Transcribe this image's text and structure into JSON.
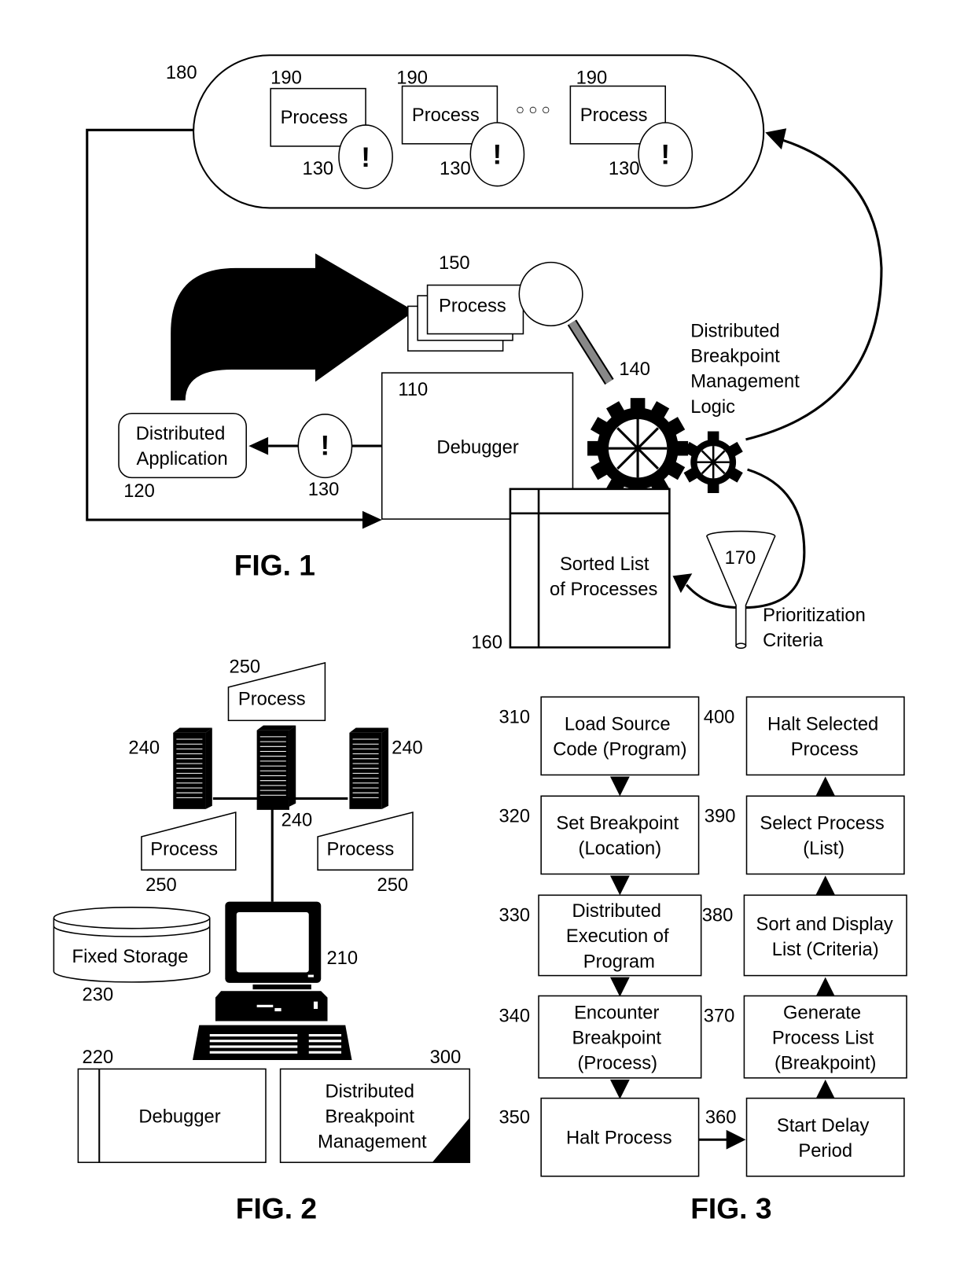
{
  "fig1": {
    "title": "FIG. 1",
    "cluster": {
      "ref": "180",
      "processes": [
        {
          "ref": "190",
          "label": "Process",
          "breakpoint_ref": "130",
          "breakpoint_symbol": "!"
        },
        {
          "ref": "190",
          "label": "Process",
          "breakpoint_ref": "130",
          "breakpoint_symbol": "!"
        },
        {
          "ref": "190",
          "label": "Process",
          "breakpoint_ref": "130",
          "breakpoint_symbol": "!"
        }
      ],
      "ellipsis": "○ ○ ○"
    },
    "process_stack": {
      "ref": "150",
      "label": "Process"
    },
    "debugger": {
      "ref": "110",
      "label": "Debugger"
    },
    "distributed_application": {
      "ref": "120",
      "line1": "Distributed",
      "line2": "Application"
    },
    "breakpoint": {
      "ref": "130",
      "symbol": "!"
    },
    "logic": {
      "ref": "140",
      "line1": "Distributed",
      "line2": "Breakpoint",
      "line3": "Management",
      "line4": "Logic"
    },
    "sorted_list": {
      "ref": "160",
      "line1": "Sorted List",
      "line2": "of Processes"
    },
    "criteria": {
      "ref": "170",
      "line1": "Prioritization",
      "line2": "Criteria"
    }
  },
  "fig2": {
    "title": "FIG. 2",
    "processes": [
      {
        "ref": "250",
        "label": "Process"
      },
      {
        "ref": "250",
        "label": "Process"
      },
      {
        "ref": "250",
        "label": "Process"
      }
    ],
    "servers": [
      {
        "ref": "240"
      },
      {
        "ref": "240"
      },
      {
        "ref": "240"
      }
    ],
    "computer": {
      "ref": "210"
    },
    "storage": {
      "ref": "230",
      "label": "Fixed Storage"
    },
    "debugger": {
      "ref": "220",
      "label": "Debugger"
    },
    "management": {
      "ref": "300",
      "line1": "Distributed",
      "line2": "Breakpoint",
      "line3": "Management"
    }
  },
  "fig3": {
    "title": "FIG. 3",
    "left_steps": [
      {
        "ref": "310",
        "lines": [
          "Load Source",
          "Code (Program)"
        ]
      },
      {
        "ref": "320",
        "lines": [
          "Set Breakpoint",
          "(Location)"
        ]
      },
      {
        "ref": "330",
        "lines": [
          "Distributed",
          "Execution of",
          "Program"
        ]
      },
      {
        "ref": "340",
        "lines": [
          "Encounter",
          "Breakpoint",
          "(Process)"
        ]
      },
      {
        "ref": "350",
        "lines": [
          "Halt Process"
        ]
      }
    ],
    "right_steps": [
      {
        "ref": "400",
        "lines": [
          "Halt Selected",
          "Process"
        ]
      },
      {
        "ref": "390",
        "lines": [
          "Select Process",
          "(List)"
        ]
      },
      {
        "ref": "380",
        "lines": [
          "Sort and Display",
          "List (Criteria)"
        ]
      },
      {
        "ref": "370",
        "lines": [
          "Generate",
          "Process List",
          "(Breakpoint)"
        ]
      },
      {
        "ref": "360",
        "lines": [
          "Start Delay",
          "Period"
        ]
      }
    ]
  }
}
